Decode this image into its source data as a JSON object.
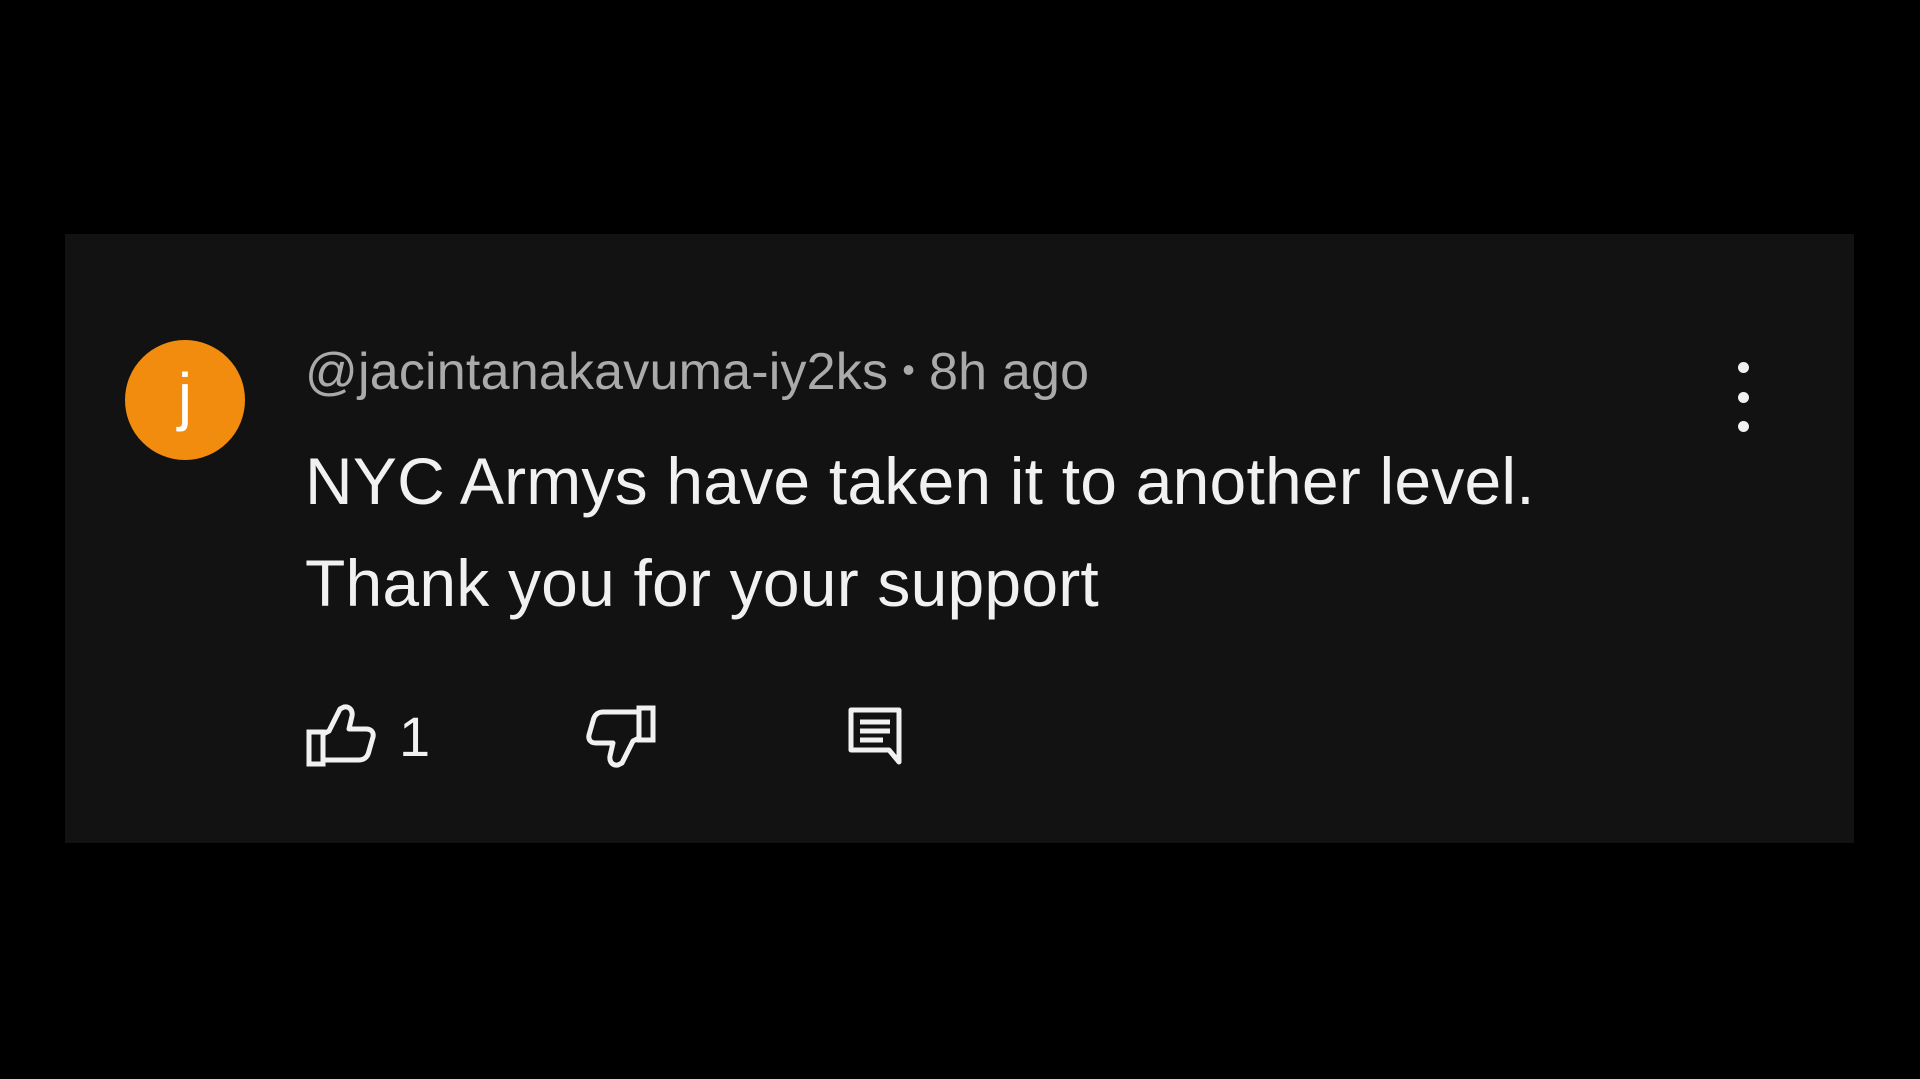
{
  "comment": {
    "avatar_letter": "j",
    "avatar_color": "#f28c0f",
    "author": "@jacintanakavuma-iy2ks",
    "separator": "•",
    "time": "8h ago",
    "text_lines": [
      "NYC Armys have taken it to another level.",
      "Thank you for your support"
    ],
    "like_count": "1"
  },
  "icons": {
    "like": "thumbs-up-icon",
    "dislike": "thumbs-down-icon",
    "reply": "reply-comment-icon",
    "more": "more-vertical-icon"
  }
}
